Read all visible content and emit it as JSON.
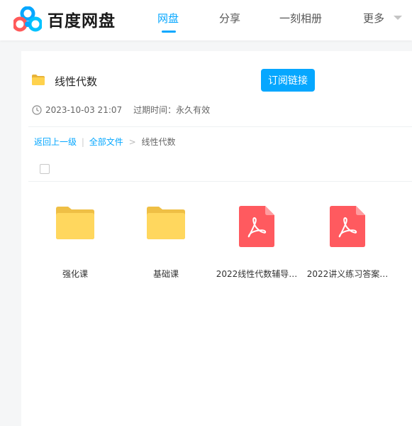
{
  "header": {
    "logo_text": "百度网盘",
    "nav": [
      {
        "label": "网盘",
        "active": true
      },
      {
        "label": "分享",
        "active": false
      },
      {
        "label": "一刻相册",
        "active": false
      },
      {
        "label": "更多",
        "active": false
      }
    ],
    "accent_color": "#06a7ff"
  },
  "share": {
    "title": "线性代数",
    "subscribe_label": "订阅链接",
    "created_at": "2023-10-03 21:07",
    "expire_text": "过期时间：永久有效"
  },
  "breadcrumb": {
    "back": "返回上一级",
    "separator": "|",
    "all_files": "全部文件",
    "arrow": ">",
    "current": "线性代数"
  },
  "files": [
    {
      "name": "强化课",
      "type": "folder-icon"
    },
    {
      "name": "基础课",
      "type": "folder-icon"
    },
    {
      "name": "2022线性代数辅导…",
      "type": "pdf-icon"
    },
    {
      "name": "2022讲义练习答案…",
      "type": "pdf-icon"
    }
  ]
}
